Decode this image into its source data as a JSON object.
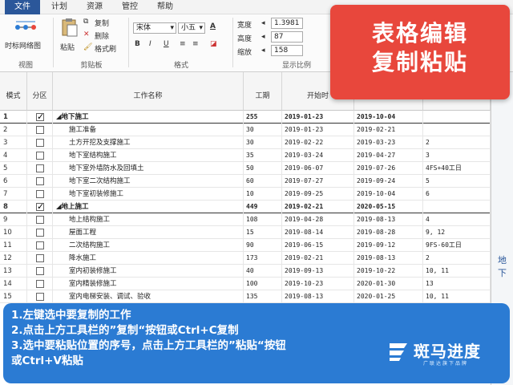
{
  "menubar": {
    "items": [
      "文件",
      "计划",
      "资源",
      "管控",
      "帮助"
    ],
    "active_index": 0
  },
  "ribbon": {
    "view_group": {
      "button": "时标网络图",
      "label": "视图"
    },
    "clipboard_group": {
      "paste": "粘贴",
      "copy": "复制",
      "delete": "删除",
      "format_painter": "格式刷",
      "label": "剪贴板"
    },
    "format_group": {
      "font": "宋体",
      "size": "小五",
      "label": "格式"
    },
    "display_group": {
      "width_label": "宽度",
      "width_value": "1.3981",
      "height_label": "高度",
      "height_value": "87",
      "zoom_label": "缩放",
      "zoom_value": "158",
      "label": "显示比例"
    }
  },
  "title_card": {
    "line1": "表格编辑",
    "line2": "复制粘贴"
  },
  "table": {
    "headers": {
      "mode": "模式",
      "partition": "分区",
      "name": "工作名称",
      "duration": "工期",
      "start": "开始时",
      "finish": ""
    },
    "rows": [
      {
        "n": "1",
        "checked": true,
        "summary": true,
        "name": "◢地下施工",
        "dur": "255",
        "start": "2019-01-23",
        "end": "2019-10-04",
        "pred": ""
      },
      {
        "n": "2",
        "checked": false,
        "summary": false,
        "name": "施工准备",
        "dur": "30",
        "start": "2019-01-23",
        "end": "2019-02-21",
        "pred": ""
      },
      {
        "n": "3",
        "checked": false,
        "summary": false,
        "name": "土方开挖及支撑施工",
        "dur": "30",
        "start": "2019-02-22",
        "end": "2019-03-23",
        "pred": "2"
      },
      {
        "n": "4",
        "checked": false,
        "summary": false,
        "name": "地下室结构施工",
        "dur": "35",
        "start": "2019-03-24",
        "end": "2019-04-27",
        "pred": "3"
      },
      {
        "n": "5",
        "checked": false,
        "summary": false,
        "name": "地下室外墙防水及回填土",
        "dur": "50",
        "start": "2019-06-07",
        "end": "2019-07-26",
        "pred": "4FS+40工日"
      },
      {
        "n": "6",
        "checked": false,
        "summary": false,
        "name": "地下室二次结构施工",
        "dur": "60",
        "start": "2019-07-27",
        "end": "2019-09-24",
        "pred": "5"
      },
      {
        "n": "7",
        "checked": false,
        "summary": false,
        "name": "地下室初装修施工",
        "dur": "10",
        "start": "2019-09-25",
        "end": "2019-10-04",
        "pred": "6"
      },
      {
        "n": "8",
        "checked": true,
        "summary": true,
        "name": "◢地上施工",
        "dur": "449",
        "start": "2019-02-21",
        "end": "2020-05-15",
        "pred": ""
      },
      {
        "n": "9",
        "checked": false,
        "summary": false,
        "name": "地上结构施工",
        "dur": "108",
        "start": "2019-04-28",
        "end": "2019-08-13",
        "pred": "4"
      },
      {
        "n": "10",
        "checked": false,
        "summary": false,
        "name": "屋面工程",
        "dur": "15",
        "start": "2019-08-14",
        "end": "2019-08-28",
        "pred": "9, 12"
      },
      {
        "n": "11",
        "checked": false,
        "summary": false,
        "name": "二次结构施工",
        "dur": "90",
        "start": "2019-06-15",
        "end": "2019-09-12",
        "pred": "9FS-60工日"
      },
      {
        "n": "12",
        "checked": false,
        "summary": false,
        "name": "降水施工",
        "dur": "173",
        "start": "2019-02-21",
        "end": "2019-08-13",
        "pred": "2"
      },
      {
        "n": "13",
        "checked": false,
        "summary": false,
        "name": "室内初装修施工",
        "dur": "40",
        "start": "2019-09-13",
        "end": "2019-10-22",
        "pred": "10, 11"
      },
      {
        "n": "14",
        "checked": false,
        "summary": false,
        "name": "室内精装修施工",
        "dur": "100",
        "start": "2019-10-23",
        "end": "2020-01-30",
        "pred": "13"
      },
      {
        "n": "15",
        "checked": false,
        "summary": false,
        "name": "室内电梯安装、调试、验收",
        "dur": "135",
        "start": "2019-08-13",
        "end": "2020-01-25",
        "pred": "10, 11"
      }
    ]
  },
  "right_pane": {
    "text": "地下"
  },
  "instructions": {
    "line1": "1.左键选中要复制的工作",
    "line2": "2.点击上方工具栏的”复制“按钮或Ctrl+C复制",
    "line3": "3.选中要粘贴位置的序号，点击上方工具栏的”粘贴“按钮",
    "line4": "或Ctrl+V粘贴"
  },
  "brand": {
    "name": "斑马进度",
    "slogan": "广联达旗下品牌"
  },
  "colors": {
    "accent": "#2b579a",
    "title_card": "#e8473c",
    "banner": "#2b7bd3"
  }
}
